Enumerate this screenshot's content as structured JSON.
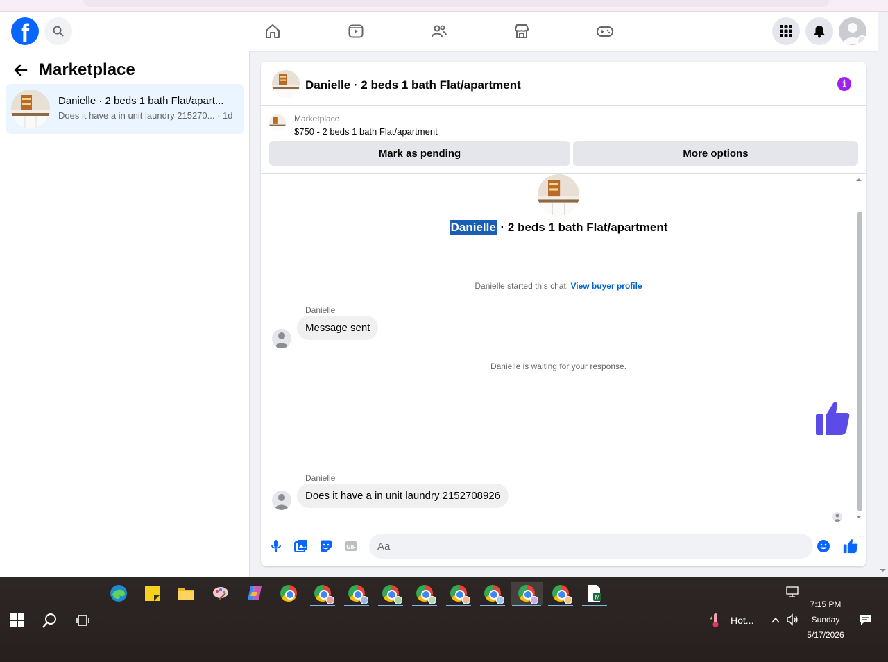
{
  "header": {
    "logo": "f",
    "nav_icons": [
      "home-icon",
      "video-icon",
      "friends-icon",
      "marketplace-icon",
      "gaming-icon"
    ],
    "right_icons": [
      "menu-grid-icon",
      "notifications-icon",
      "account-icon"
    ]
  },
  "sidebar": {
    "title": "Marketplace",
    "conversation": {
      "name": "Danielle · 2 beds 1 bath Flat/apart...",
      "preview": "Does it have a in unit laundry 215270... · 1d"
    }
  },
  "chat": {
    "title": "Danielle · 2 beds 1 bath Flat/apartment",
    "listing": {
      "label": "Marketplace",
      "price_title": "$750 - 2 beds 1 bath Flat/apartment"
    },
    "buttons": {
      "pending": "Mark as pending",
      "more": "More options"
    },
    "center": {
      "name_highlight": "Danielle",
      "title_rest": " · 2 beds 1 bath Flat/apartment"
    },
    "system": {
      "started": "Danielle started this chat.",
      "view_profile": "View buyer profile",
      "waiting": "Danielle is waiting for your response."
    },
    "messages": [
      {
        "sender": "Danielle",
        "text": "Message sent"
      },
      {
        "sender": "Danielle",
        "text": "Does it have a in unit laundry 2152708926"
      }
    ],
    "composer": {
      "placeholder": "Aa"
    }
  },
  "taskbar": {
    "weather": "Hot...",
    "time": "7:15 PM",
    "day": "Sunday",
    "date": "5/17/2026"
  },
  "colors": {
    "facebook_blue": "#0866ff",
    "highlight": "#1a5fb4",
    "like_purple": "#5b4ce8",
    "info_purple": "#a020f0"
  }
}
